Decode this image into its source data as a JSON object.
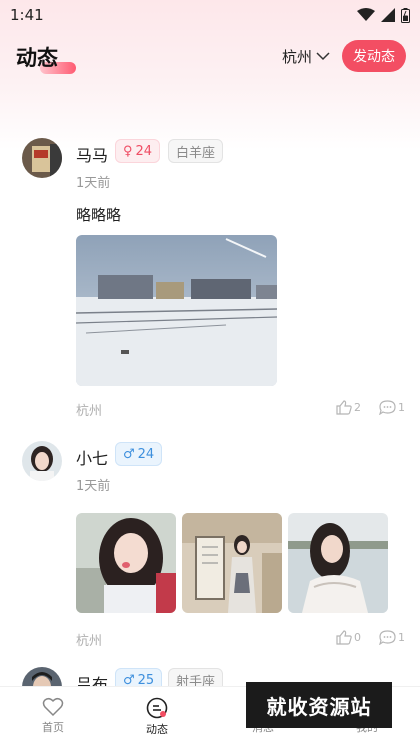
{
  "status_bar": {
    "time": "1:41"
  },
  "header": {
    "title": "动态",
    "city": "杭州",
    "post_button": "发动态"
  },
  "posts": [
    {
      "name": "马马",
      "gender": "female",
      "gender_symbol": "♀",
      "age": "24",
      "zodiac": "白羊座",
      "time": "1天前",
      "text": "略略略",
      "city": "杭州",
      "likes": "2",
      "comments": "1",
      "images": [
        "snowy-railway-landscape"
      ]
    },
    {
      "name": "小七",
      "gender": "male",
      "gender_symbol": "♂",
      "age": "24",
      "time": "1天前",
      "city": "杭州",
      "likes": "0",
      "comments": "1",
      "images": [
        "selfie-girl",
        "girl-in-qipao-by-sign",
        "girl-by-lake"
      ]
    },
    {
      "name": "吕布",
      "gender": "male",
      "gender_symbol": "♂",
      "age": "25",
      "zodiac": "射手座"
    }
  ],
  "tabbar": {
    "items": [
      {
        "label": "首页",
        "icon": "heart-icon"
      },
      {
        "label": "动态",
        "icon": "feed-icon",
        "active": true
      },
      {
        "label": "消息",
        "icon": "message-icon"
      },
      {
        "label": "我的",
        "icon": "profile-icon"
      }
    ]
  },
  "watermark": "就收资源站",
  "colors": {
    "accent": "#f34e63",
    "female": "#ef4d64",
    "male": "#3d8fdd"
  }
}
